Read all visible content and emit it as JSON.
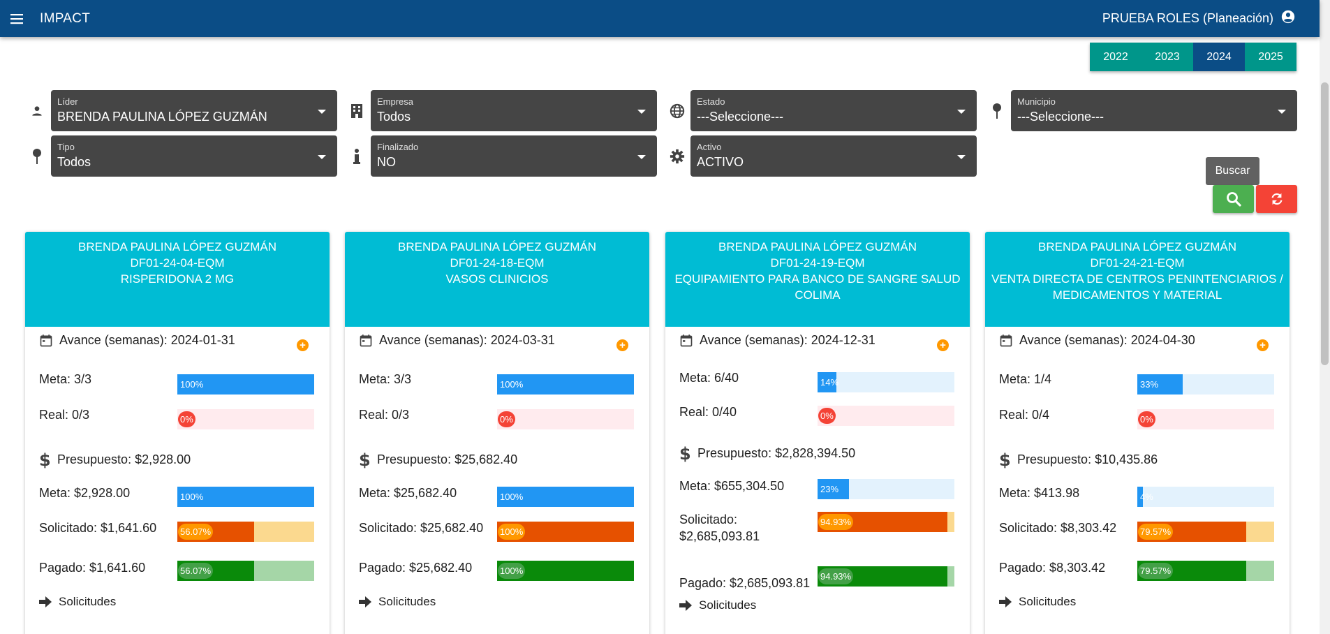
{
  "app": {
    "title": "IMPACT",
    "user": "PRUEBA ROLES (Planeación)"
  },
  "years": {
    "items": [
      "2022",
      "2023",
      "2024",
      "2025"
    ],
    "active": "2024"
  },
  "filters": {
    "lider": {
      "label": "Líder",
      "value": "BRENDA PAULINA LÓPEZ GUZMÁN"
    },
    "empresa": {
      "label": "Empresa",
      "value": "Todos"
    },
    "estado": {
      "label": "Estado",
      "value": "---Seleccione---"
    },
    "municipio": {
      "label": "Municipio",
      "value": "---Seleccione---"
    },
    "tipo": {
      "label": "Tipo",
      "value": "Todos"
    },
    "finalizado": {
      "label": "Finalizado",
      "value": "NO"
    },
    "activo": {
      "label": "Activo",
      "value": "ACTIVO"
    }
  },
  "actions": {
    "search_tooltip": "Buscar"
  },
  "colors": {
    "blue": "#2196f3",
    "blue_light": "#e3f2fd",
    "red": "#f44336",
    "red_light": "#ffebee",
    "orange": "#e65100",
    "orange_pill": "#ff9800",
    "orange_light": "#fbd98f",
    "green": "#0a8a0a",
    "green_pill": "#43a047",
    "green_light": "#a5d6a7"
  },
  "cards": [
    {
      "leader": "BRENDA PAULINA LÓPEZ GUZMÁN",
      "code": "DF01-24-04-EQM",
      "name": "RISPERIDONA 2 MG",
      "avance": "Avance (semanas): 2024-01-31",
      "meta_label": "Meta: 3/3",
      "meta_pct": "100%",
      "meta_value": 1.0,
      "real_label": "Real: 0/3",
      "real_pct": "0%",
      "real_value": 0.0,
      "presupuesto": "Presupuesto: $2,928.00",
      "meta_money_label": "Meta: $2,928.00",
      "meta_money_pct": "100%",
      "meta_money_value": 1.0,
      "solicitado_label": "Solicitado: $1,641.60",
      "solicitado_pct": "56.07%",
      "solicitado_value": 0.5607,
      "pagado_label": "Pagado: $1,641.60",
      "pagado_pct": "56.07%",
      "pagado_value": 0.5607,
      "solicitudes": "Solicitudes"
    },
    {
      "leader": "BRENDA PAULINA LÓPEZ GUZMÁN",
      "code": "DF01-24-18-EQM",
      "name": "VASOS CLINICIOS",
      "avance": "Avance (semanas): 2024-03-31",
      "meta_label": "Meta: 3/3",
      "meta_pct": "100%",
      "meta_value": 1.0,
      "real_label": "Real: 0/3",
      "real_pct": "0%",
      "real_value": 0.0,
      "presupuesto": "Presupuesto: $25,682.40",
      "meta_money_label": "Meta: $25,682.40",
      "meta_money_pct": "100%",
      "meta_money_value": 1.0,
      "solicitado_label": "Solicitado: $25,682.40",
      "solicitado_pct": "100%",
      "solicitado_value": 1.0,
      "pagado_label": "Pagado: $25,682.40",
      "pagado_pct": "100%",
      "pagado_value": 1.0,
      "solicitudes": "Solicitudes"
    },
    {
      "leader": "BRENDA PAULINA LÓPEZ GUZMÁN",
      "code": "DF01-24-19-EQM",
      "name": "EQUIPAMIENTO PARA BANCO DE SANGRE SALUD COLIMA",
      "avance": "Avance (semanas): 2024-12-31",
      "meta_label": "Meta: 6/40",
      "meta_pct": "14%",
      "meta_value": 0.14,
      "real_label": "Real: 0/40",
      "real_pct": "0%",
      "real_value": 0.0,
      "presupuesto": "Presupuesto: $2,828,394.50",
      "meta_money_label": "Meta: $655,304.50",
      "meta_money_pct": "23%",
      "meta_money_value": 0.23,
      "solicitado_label": "Solicitado: $2,685,093.81",
      "solicitado_pct": "94.93%",
      "solicitado_value": 0.9493,
      "pagado_label": "Pagado: $2,685,093.81",
      "pagado_pct": "94.93%",
      "pagado_value": 0.9493,
      "solicitudes": "Solicitudes"
    },
    {
      "leader": "BRENDA PAULINA LÓPEZ GUZMÁN",
      "code": "DF01-24-21-EQM",
      "name": "VENTA DIRECTA DE CENTROS PENINTENCIARIOS / MEDICAMENTOS Y MATERIAL",
      "avance": "Avance (semanas): 2024-04-30",
      "meta_label": "Meta: 1/4",
      "meta_pct": "33%",
      "meta_value": 0.33,
      "real_label": "Real: 0/4",
      "real_pct": "0%",
      "real_value": 0.0,
      "presupuesto": "Presupuesto: $10,435.86",
      "meta_money_label": "Meta: $413.98",
      "meta_money_pct": "4%",
      "meta_money_value": 0.04,
      "solicitado_label": "Solicitado: $8,303.42",
      "solicitado_pct": "79.57%",
      "solicitado_value": 0.7957,
      "pagado_label": "Pagado: $8,303.42",
      "pagado_pct": "79.57%",
      "pagado_value": 0.7957,
      "solicitudes": "Solicitudes"
    }
  ]
}
